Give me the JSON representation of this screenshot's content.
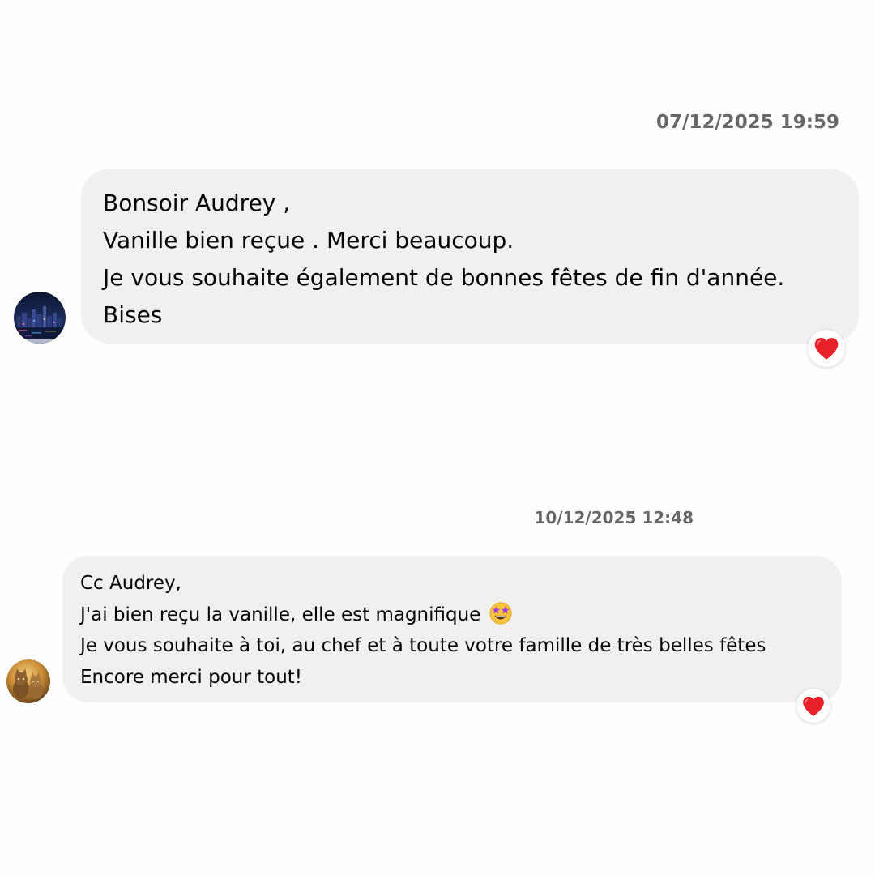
{
  "messages": [
    {
      "timestamp": "07/12/2025 19:59",
      "lines": [
        "Bonsoir Audrey ,",
        "Vanille bien reçue . Merci beaucoup.",
        "Je vous souhaite également de bonnes fêtes de fin d'année.",
        "Bises"
      ],
      "reaction": "heart-icon"
    },
    {
      "timestamp": "10/12/2025 12:48",
      "lines": [
        "Cc Audrey,",
        "J'ai bien reçu la vanille, elle est magnifique",
        "Je vous souhaite à toi, au chef et à toute votre famille de très belles fêtes",
        "Encore merci pour tout!"
      ],
      "inline_emoji": "star-struck-emoji",
      "reaction": "heart-icon"
    }
  ],
  "colors": {
    "bubble": "#f0f0f0",
    "timestamp": "#65676b",
    "heart": "#e8202a"
  }
}
